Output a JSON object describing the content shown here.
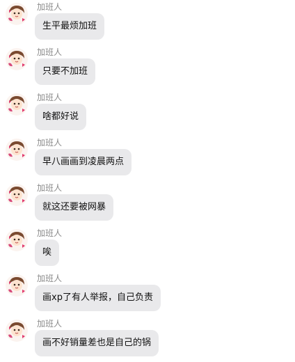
{
  "messages": [
    {
      "sender": "加班人",
      "text": "生平最烦加班",
      "avatar": "cartoon-girl-avatar"
    },
    {
      "sender": "加班人",
      "text": "只要不加班",
      "avatar": "cartoon-girl-avatar"
    },
    {
      "sender": "加班人",
      "text": "啥都好说",
      "avatar": "cartoon-girl-avatar"
    },
    {
      "sender": "加班人",
      "text": "早八画画到凌晨两点",
      "avatar": "cartoon-girl-avatar"
    },
    {
      "sender": "加班人",
      "text": "就这还要被网暴",
      "avatar": "cartoon-girl-avatar"
    },
    {
      "sender": "加班人",
      "text": "唉",
      "avatar": "cartoon-girl-avatar"
    },
    {
      "sender": "加班人",
      "text": "画xp了有人举报，自己负责",
      "avatar": "cartoon-girl-avatar"
    },
    {
      "sender": "加班人",
      "text": "画不好销量差也是自己的锅",
      "avatar": "cartoon-girl-avatar"
    }
  ],
  "colors": {
    "bubble": "#e9e9eb",
    "sender": "#8a8a8a",
    "text": "#111111",
    "background": "#ffffff"
  }
}
